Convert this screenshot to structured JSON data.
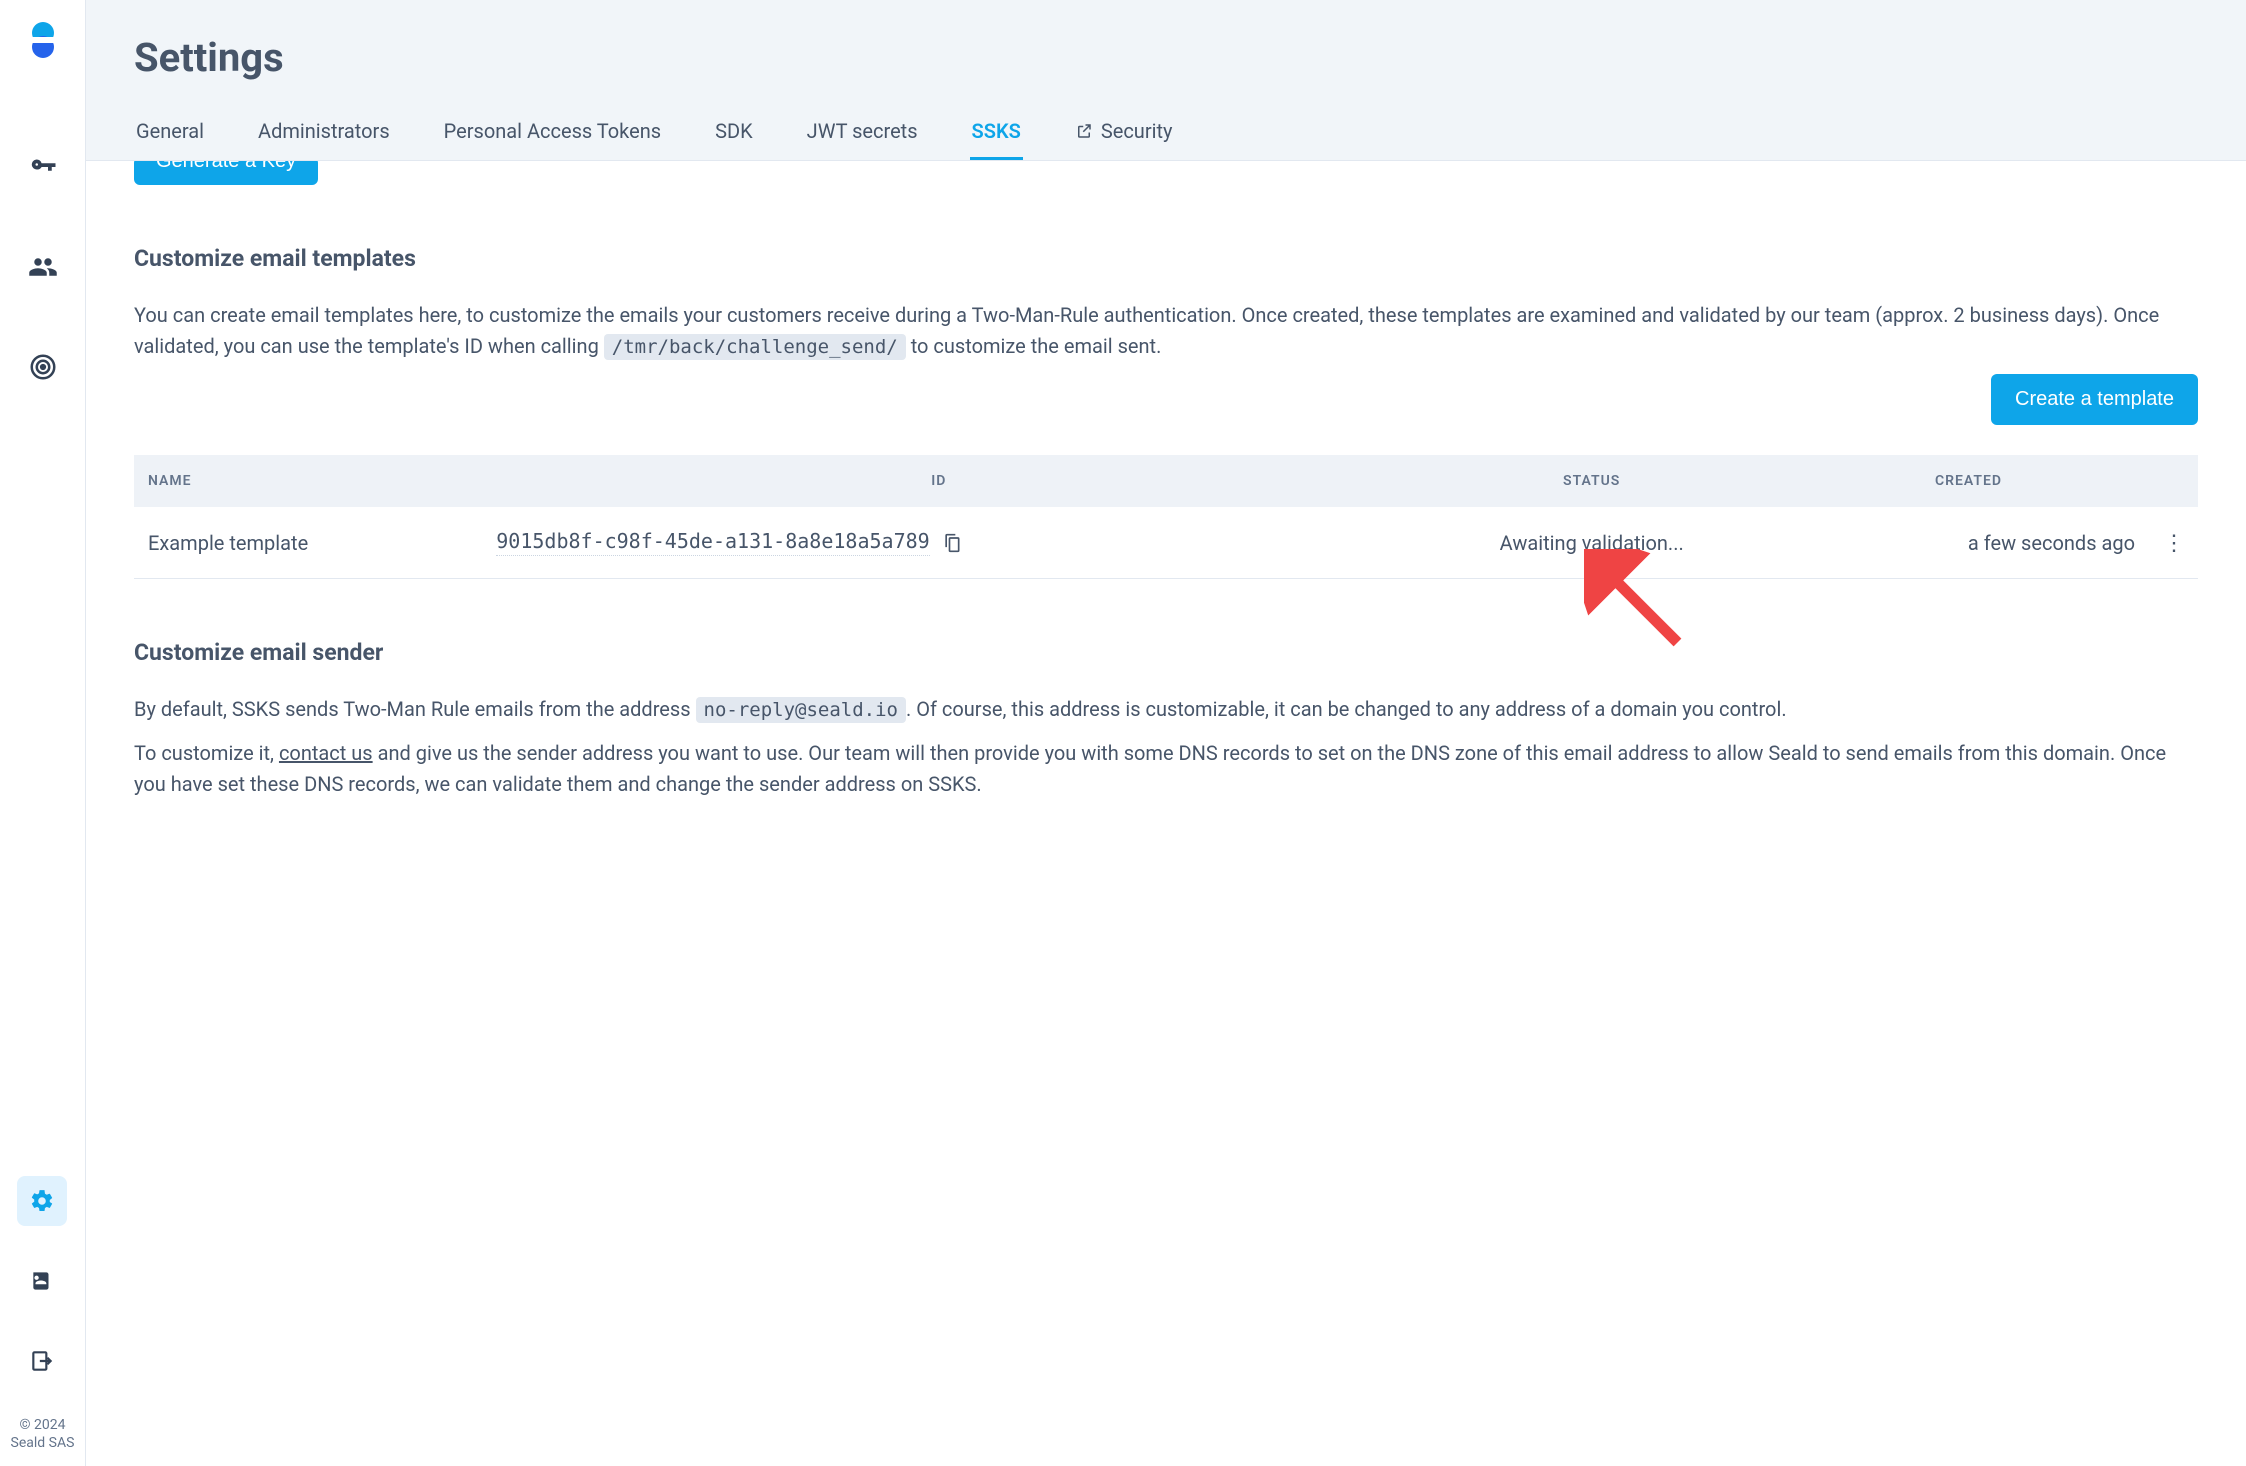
{
  "page": {
    "title": "Settings"
  },
  "tabs": [
    {
      "label": "General"
    },
    {
      "label": "Administrators"
    },
    {
      "label": "Personal Access Tokens"
    },
    {
      "label": "SDK"
    },
    {
      "label": "JWT secrets"
    },
    {
      "label": "SSKS",
      "active": true
    },
    {
      "label": "Security",
      "external": true
    }
  ],
  "partial_button": {
    "label": "Generate a Key"
  },
  "templates_section": {
    "title": "Customize email templates",
    "desc_before_code": "You can create email templates here, to customize the emails your customers receive during a Two-Man-Rule authentication. Once created, these templates are examined and validated by our team (approx. 2 business days). Once validated, you can use the template's ID when calling ",
    "code": "/tmr/back/challenge_send/",
    "desc_after_code": " to customize the email sent.",
    "create_button": "Create a template",
    "columns": {
      "name": "NAME",
      "id": "ID",
      "status": "STATUS",
      "created": "CREATED"
    },
    "rows": [
      {
        "name": "Example template",
        "id_value": "9015db8f-c98f-45de-a131-8a8e18a5a789",
        "status": "Awaiting validation...",
        "created": "a few seconds ago"
      }
    ]
  },
  "sender_section": {
    "title": "Customize email sender",
    "p1_before": "By default, SSKS sends Two-Man Rule emails from the address ",
    "p1_code": "no-reply@seald.io",
    "p1_after": ". Of course, this address is customizable, it can be changed to any address of a domain you control.",
    "p2_before": "To customize it, ",
    "p2_link": "contact us",
    "p2_after": " and give us the sender address you want to use. Our team will then provide you with some DNS records to set on the DNS zone of this email address to allow Seald to send emails from this domain. Once you have set these DNS records, we can validate them and change the sender address on SSKS."
  },
  "footer": {
    "copyright_line1": "© 2024",
    "copyright_line2": "Seald SAS"
  }
}
